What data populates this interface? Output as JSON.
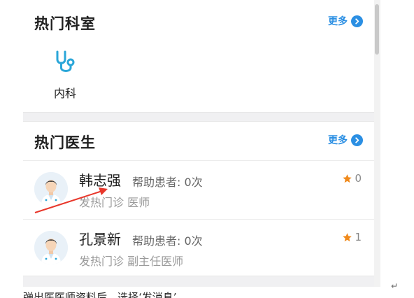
{
  "hot_departments": {
    "title": "热门科室",
    "more_label": "更多",
    "items": [
      {
        "label": "内科",
        "icon": "stethoscope-icon"
      }
    ]
  },
  "hot_doctors": {
    "title": "热门医生",
    "more_label": "更多",
    "items": [
      {
        "name": "韩志强",
        "help": "帮助患者: 0次",
        "subtitle": "发热门诊 医师",
        "rating": "0"
      },
      {
        "name": "孔景新",
        "help": "帮助患者: 0次",
        "subtitle": "发热门诊 副主任医师",
        "rating": "1"
      }
    ]
  },
  "caption": "弹出医医师资料后，选择‘发消息’。",
  "colors": {
    "accent": "#2b8fe3",
    "star": "#f08a1c",
    "icon": "#2aa6d8",
    "annotation_arrow": "#e8372b"
  }
}
